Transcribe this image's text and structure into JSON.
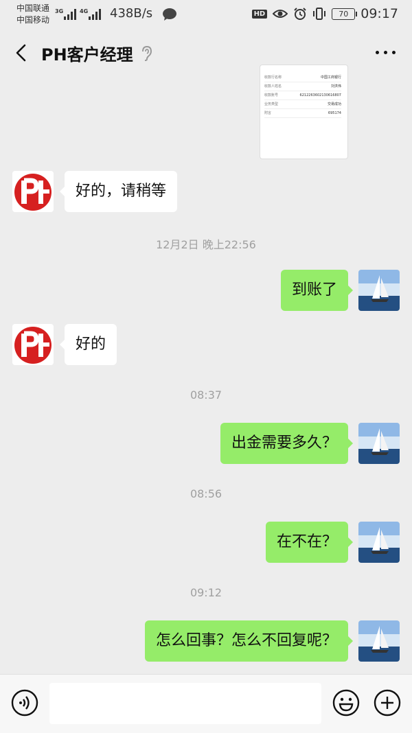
{
  "status_bar": {
    "carrier1": "中国联通",
    "carrier2": "中国移动",
    "net1": "3G",
    "net2": "4G",
    "speed": "438B/s",
    "hd": "HD",
    "battery": "70",
    "time": "09:17"
  },
  "header": {
    "title": "PH客户经理"
  },
  "receipt": {
    "rows": [
      {
        "label": "收款行名称",
        "value": "中国工商银行"
      },
      {
        "label": "收款人姓名",
        "value": "刘洪伟"
      },
      {
        "label": "收款账号",
        "value": "6212263602130616807"
      },
      {
        "label": "业务类型",
        "value": "交易成功"
      },
      {
        "label": "附言",
        "value": "695174"
      }
    ]
  },
  "messages": {
    "m1": "好的，请稍等",
    "t1": "12月2日 晚上22:56",
    "m2": "到账了",
    "m3": "好的",
    "t2": "08:37",
    "m4": "出金需要多久？",
    "t3": "08:56",
    "m5": "在不在？",
    "t4": "09:12",
    "m6": "怎么回事？怎么不回复呢？"
  },
  "colors": {
    "outgoing_bubble": "#95ec69",
    "incoming_bubble": "#ffffff",
    "background": "#ededed"
  }
}
